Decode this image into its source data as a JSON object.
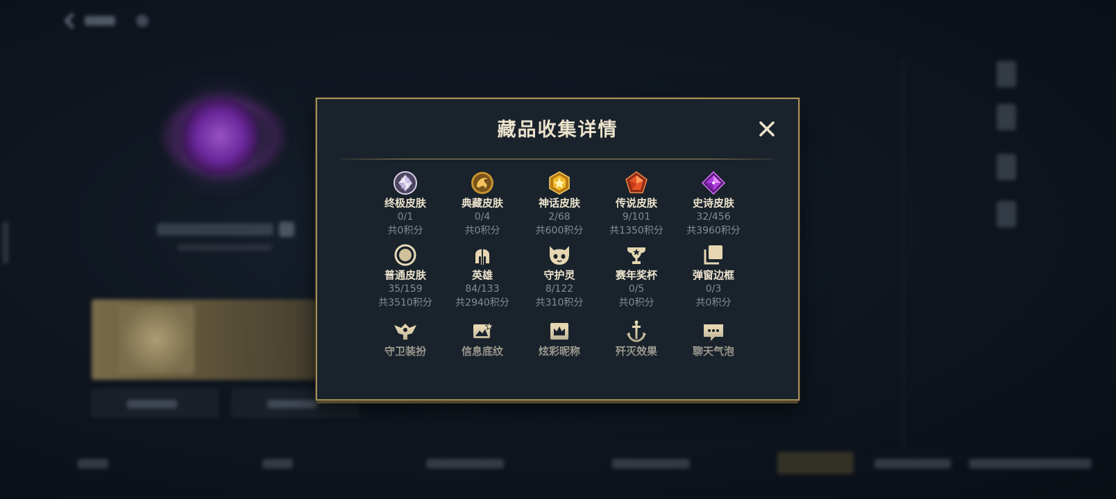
{
  "modal": {
    "title": "藏品收集详情",
    "close_glyph": "✕"
  },
  "colors": {
    "accent_gold": "#a8915c",
    "title_text": "#ece3cd",
    "muted_text": "#858c95",
    "panel_bg": "#1a232c"
  },
  "items": [
    {
      "icon": "ultimate-skin-gem-icon",
      "label": "终极皮肤",
      "count": "0/1",
      "points": "共0积分"
    },
    {
      "icon": "collector-skin-dragon-icon",
      "label": "典藏皮肤",
      "count": "0/4",
      "points": "共0积分"
    },
    {
      "icon": "mythic-skin-gem-icon",
      "label": "神话皮肤",
      "count": "2/68",
      "points": "共600积分"
    },
    {
      "icon": "legendary-skin-gem-icon",
      "label": "传说皮肤",
      "count": "9/101",
      "points": "共1350积分"
    },
    {
      "icon": "epic-skin-gem-icon",
      "label": "史诗皮肤",
      "count": "32/456",
      "points": "共3960积分"
    },
    {
      "icon": "normal-skin-ring-icon",
      "label": "普通皮肤",
      "count": "35/159",
      "points": "共3510积分"
    },
    {
      "icon": "hero-helmet-icon",
      "label": "英雄",
      "count": "84/133",
      "points": "共2940积分"
    },
    {
      "icon": "spirit-pet-icon",
      "label": "守护灵",
      "count": "8/122",
      "points": "共310积分"
    },
    {
      "icon": "season-trophy-icon",
      "label": "赛年奖杯",
      "count": "0/5",
      "points": "共0积分"
    },
    {
      "icon": "popup-frame-icon",
      "label": "弹窗边框",
      "count": "0/3",
      "points": "共0积分"
    },
    {
      "icon": "guard-outfit-icon",
      "label": "守卫装扮"
    },
    {
      "icon": "info-card-icon",
      "label": "信息底纹"
    },
    {
      "icon": "nickname-crown-icon",
      "label": "炫彩昵称"
    },
    {
      "icon": "takedown-effect-icon",
      "label": "歼灭效果"
    },
    {
      "icon": "chat-bubble-icon",
      "label": "聊天气泡"
    }
  ]
}
